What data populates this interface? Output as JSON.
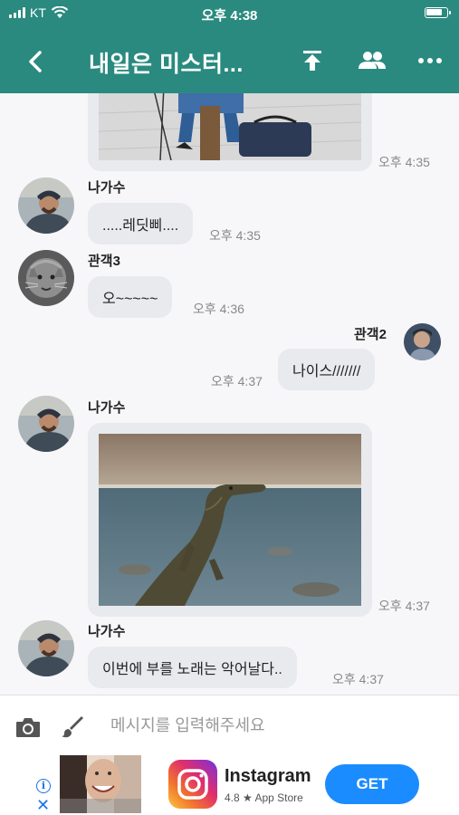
{
  "status_bar": {
    "carrier": "KT",
    "time": "오후 4:38"
  },
  "header": {
    "title": "내일은 미스터...",
    "icons": [
      "back-chevron-icon",
      "upload-icon",
      "people-icon",
      "more-icon"
    ]
  },
  "messages": [
    {
      "type": "image",
      "side": "left",
      "time": "오후 4:35"
    },
    {
      "type": "text",
      "side": "left",
      "sender": "나가수",
      "text": ".....레딧삐....",
      "time": "오후 4:35"
    },
    {
      "type": "text",
      "side": "left",
      "sender": "관객3",
      "text": "오~~~~~",
      "time": "오후 4:36"
    },
    {
      "type": "text",
      "side": "right",
      "sender": "관객2",
      "text": "나이스///////",
      "time": "오후 4:37"
    },
    {
      "type": "image",
      "side": "left",
      "sender": "나가수",
      "time": "오후 4:37"
    },
    {
      "type": "text",
      "side": "left",
      "sender": "나가수",
      "text": "이번에 부를 노래는 악어날다..",
      "time": "오후 4:37"
    }
  ],
  "composer": {
    "placeholder": "메시지를 입력해주세요"
  },
  "ad": {
    "app_name": "Instagram",
    "rating": "4.8 ★ App Store",
    "cta": "GET"
  },
  "colors": {
    "header": "#2a8a7f",
    "bubble": "#e9eaee",
    "background": "#f7f7f9",
    "cta": "#1a8cff"
  }
}
